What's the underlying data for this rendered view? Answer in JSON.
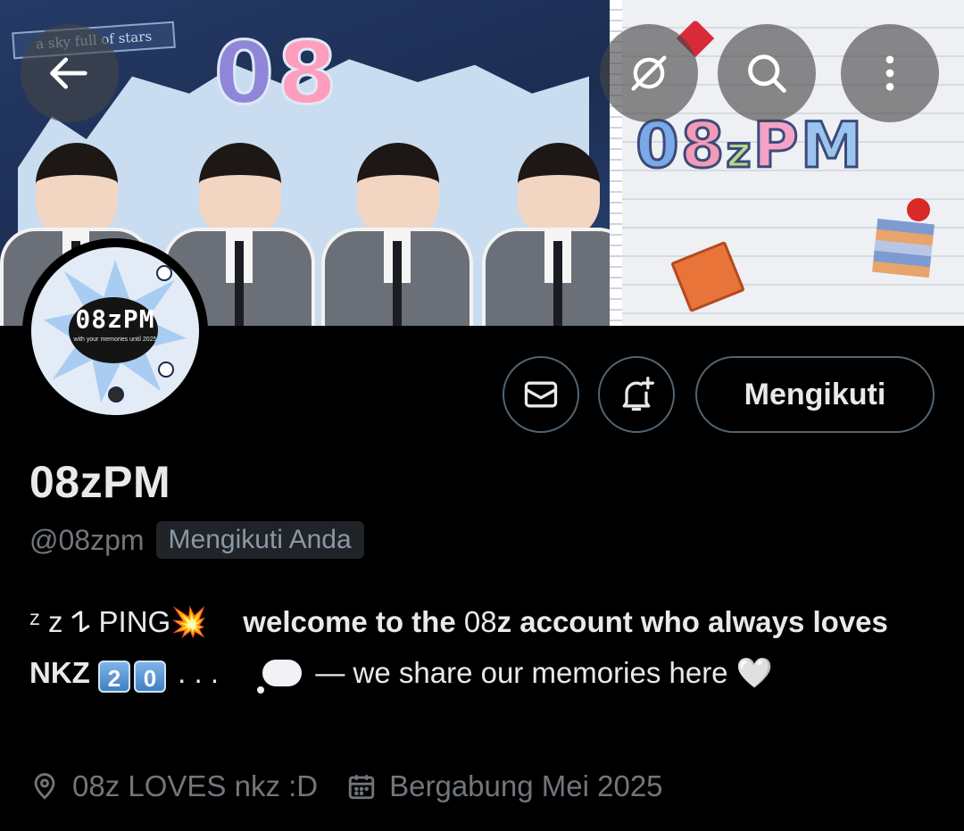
{
  "banner": {
    "label": "a sky full of stars",
    "big_digits": [
      "0",
      "8"
    ],
    "logo_letters": [
      "0",
      "8",
      "z",
      "P",
      "M"
    ]
  },
  "header_actions": {
    "back_icon": "arrow-left-icon",
    "hide_icon": "eye-slash-icon",
    "search_icon": "search-icon",
    "more_icon": "more-vertical-icon"
  },
  "avatar": {
    "text": "08zPM",
    "subtext": "with your memories until 2025"
  },
  "actions": {
    "message_icon": "envelope-icon",
    "notify_icon": "bell-plus-icon",
    "following_label": "Mengikuti"
  },
  "profile": {
    "display_name": "08zPM",
    "handle": "@08zpm",
    "follows_you_badge": "Mengikuti Anda"
  },
  "bio": {
    "lead": "ᶻ z 𐰁 PING💥",
    "welcome_a": "welcome to the ",
    "welcome_num": "08",
    "welcome_b": "z account who always loves NKZ",
    "key_badges": [
      "2",
      "0"
    ],
    "dots": ". . .",
    "memories": "— we share our memories here",
    "heart": "🤍"
  },
  "meta": {
    "location": "08z LOVES nkz :D",
    "joined": "Bergabung Mei 2025",
    "location_icon": "location-pin-icon",
    "calendar_icon": "calendar-icon"
  },
  "colors": {
    "background": "#000000",
    "primary_text": "#e7e9ea",
    "secondary_text": "#71767b",
    "border": "#536471",
    "badge_bg": "#202327"
  }
}
